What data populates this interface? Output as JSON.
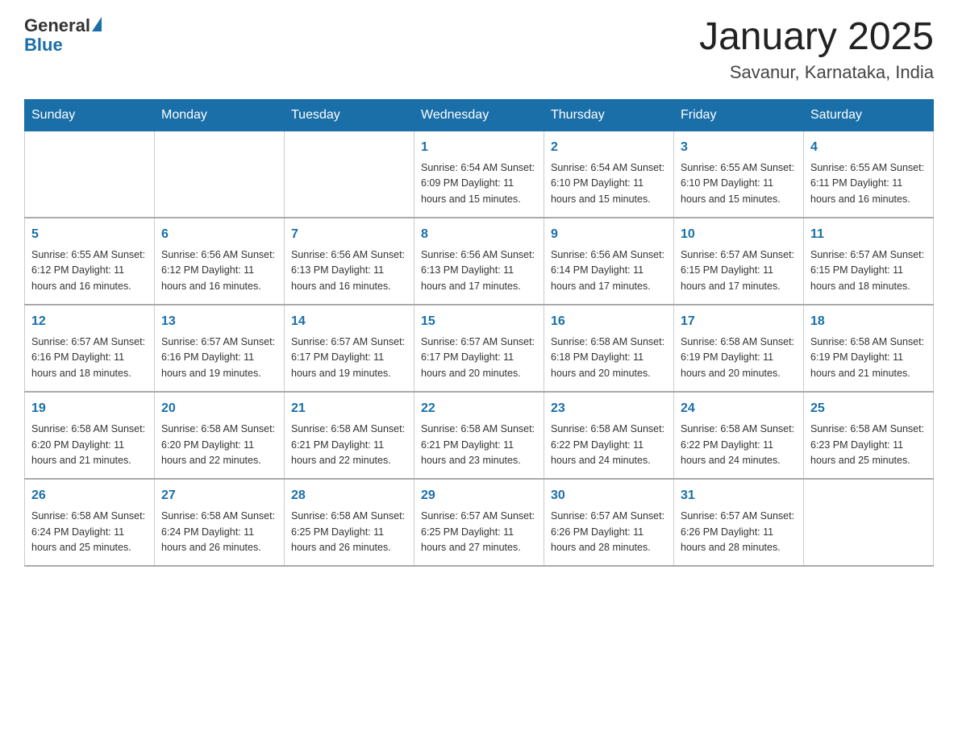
{
  "header": {
    "logo_general": "General",
    "logo_blue": "Blue",
    "title": "January 2025",
    "subtitle": "Savanur, Karnataka, India"
  },
  "days_of_week": [
    "Sunday",
    "Monday",
    "Tuesday",
    "Wednesday",
    "Thursday",
    "Friday",
    "Saturday"
  ],
  "weeks": [
    {
      "days": [
        {
          "num": "",
          "info": ""
        },
        {
          "num": "",
          "info": ""
        },
        {
          "num": "",
          "info": ""
        },
        {
          "num": "1",
          "info": "Sunrise: 6:54 AM\nSunset: 6:09 PM\nDaylight: 11 hours and 15 minutes."
        },
        {
          "num": "2",
          "info": "Sunrise: 6:54 AM\nSunset: 6:10 PM\nDaylight: 11 hours and 15 minutes."
        },
        {
          "num": "3",
          "info": "Sunrise: 6:55 AM\nSunset: 6:10 PM\nDaylight: 11 hours and 15 minutes."
        },
        {
          "num": "4",
          "info": "Sunrise: 6:55 AM\nSunset: 6:11 PM\nDaylight: 11 hours and 16 minutes."
        }
      ]
    },
    {
      "days": [
        {
          "num": "5",
          "info": "Sunrise: 6:55 AM\nSunset: 6:12 PM\nDaylight: 11 hours and 16 minutes."
        },
        {
          "num": "6",
          "info": "Sunrise: 6:56 AM\nSunset: 6:12 PM\nDaylight: 11 hours and 16 minutes."
        },
        {
          "num": "7",
          "info": "Sunrise: 6:56 AM\nSunset: 6:13 PM\nDaylight: 11 hours and 16 minutes."
        },
        {
          "num": "8",
          "info": "Sunrise: 6:56 AM\nSunset: 6:13 PM\nDaylight: 11 hours and 17 minutes."
        },
        {
          "num": "9",
          "info": "Sunrise: 6:56 AM\nSunset: 6:14 PM\nDaylight: 11 hours and 17 minutes."
        },
        {
          "num": "10",
          "info": "Sunrise: 6:57 AM\nSunset: 6:15 PM\nDaylight: 11 hours and 17 minutes."
        },
        {
          "num": "11",
          "info": "Sunrise: 6:57 AM\nSunset: 6:15 PM\nDaylight: 11 hours and 18 minutes."
        }
      ]
    },
    {
      "days": [
        {
          "num": "12",
          "info": "Sunrise: 6:57 AM\nSunset: 6:16 PM\nDaylight: 11 hours and 18 minutes."
        },
        {
          "num": "13",
          "info": "Sunrise: 6:57 AM\nSunset: 6:16 PM\nDaylight: 11 hours and 19 minutes."
        },
        {
          "num": "14",
          "info": "Sunrise: 6:57 AM\nSunset: 6:17 PM\nDaylight: 11 hours and 19 minutes."
        },
        {
          "num": "15",
          "info": "Sunrise: 6:57 AM\nSunset: 6:17 PM\nDaylight: 11 hours and 20 minutes."
        },
        {
          "num": "16",
          "info": "Sunrise: 6:58 AM\nSunset: 6:18 PM\nDaylight: 11 hours and 20 minutes."
        },
        {
          "num": "17",
          "info": "Sunrise: 6:58 AM\nSunset: 6:19 PM\nDaylight: 11 hours and 20 minutes."
        },
        {
          "num": "18",
          "info": "Sunrise: 6:58 AM\nSunset: 6:19 PM\nDaylight: 11 hours and 21 minutes."
        }
      ]
    },
    {
      "days": [
        {
          "num": "19",
          "info": "Sunrise: 6:58 AM\nSunset: 6:20 PM\nDaylight: 11 hours and 21 minutes."
        },
        {
          "num": "20",
          "info": "Sunrise: 6:58 AM\nSunset: 6:20 PM\nDaylight: 11 hours and 22 minutes."
        },
        {
          "num": "21",
          "info": "Sunrise: 6:58 AM\nSunset: 6:21 PM\nDaylight: 11 hours and 22 minutes."
        },
        {
          "num": "22",
          "info": "Sunrise: 6:58 AM\nSunset: 6:21 PM\nDaylight: 11 hours and 23 minutes."
        },
        {
          "num": "23",
          "info": "Sunrise: 6:58 AM\nSunset: 6:22 PM\nDaylight: 11 hours and 24 minutes."
        },
        {
          "num": "24",
          "info": "Sunrise: 6:58 AM\nSunset: 6:22 PM\nDaylight: 11 hours and 24 minutes."
        },
        {
          "num": "25",
          "info": "Sunrise: 6:58 AM\nSunset: 6:23 PM\nDaylight: 11 hours and 25 minutes."
        }
      ]
    },
    {
      "days": [
        {
          "num": "26",
          "info": "Sunrise: 6:58 AM\nSunset: 6:24 PM\nDaylight: 11 hours and 25 minutes."
        },
        {
          "num": "27",
          "info": "Sunrise: 6:58 AM\nSunset: 6:24 PM\nDaylight: 11 hours and 26 minutes."
        },
        {
          "num": "28",
          "info": "Sunrise: 6:58 AM\nSunset: 6:25 PM\nDaylight: 11 hours and 26 minutes."
        },
        {
          "num": "29",
          "info": "Sunrise: 6:57 AM\nSunset: 6:25 PM\nDaylight: 11 hours and 27 minutes."
        },
        {
          "num": "30",
          "info": "Sunrise: 6:57 AM\nSunset: 6:26 PM\nDaylight: 11 hours and 28 minutes."
        },
        {
          "num": "31",
          "info": "Sunrise: 6:57 AM\nSunset: 6:26 PM\nDaylight: 11 hours and 28 minutes."
        },
        {
          "num": "",
          "info": ""
        }
      ]
    }
  ]
}
